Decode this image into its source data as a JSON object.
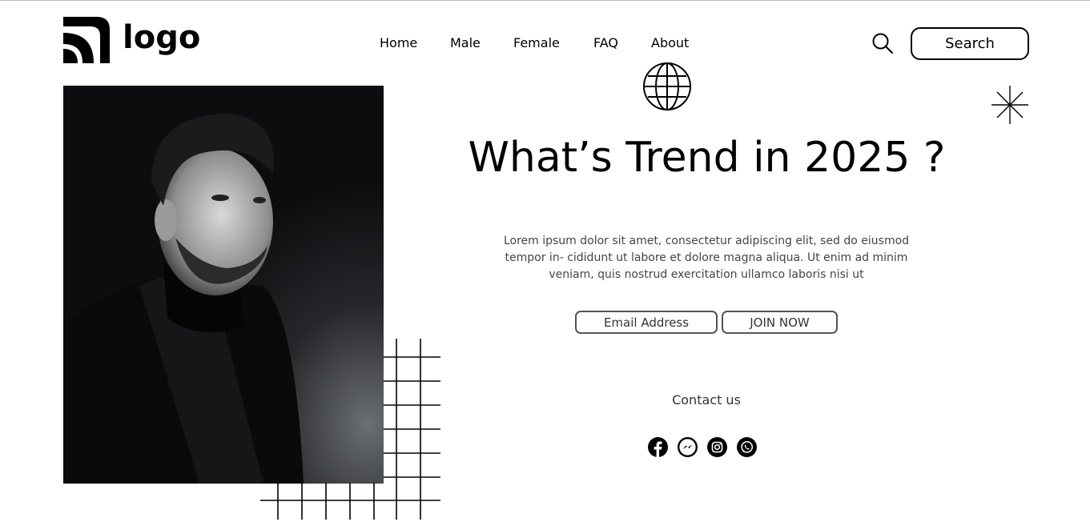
{
  "header": {
    "logo_text": "logo",
    "nav": [
      "Home",
      "Male",
      "Female",
      "FAQ",
      "About"
    ],
    "search_label": "Search"
  },
  "hero": {
    "title": "What’s Trend in 2025 ?",
    "body": "Lorem ipsum dolor sit amet, consectetur adipiscing elit, sed do eiusmod tempor in- cididunt ut labore et dolore magna aliqua. Ut enim ad minim veniam, quis nostrud exercitation ullamco laboris nisi ut",
    "email_placeholder": "Email Address",
    "join_label": "JOIN NOW",
    "contact_label": "Contact us"
  },
  "socials": [
    "facebook-icon",
    "messenger-icon",
    "instagram-icon",
    "whatsapp-icon"
  ],
  "colors": {
    "text": "#000000",
    "muted_text": "#444444",
    "background": "#ffffff",
    "photo_bg": "#0c0d0f"
  }
}
